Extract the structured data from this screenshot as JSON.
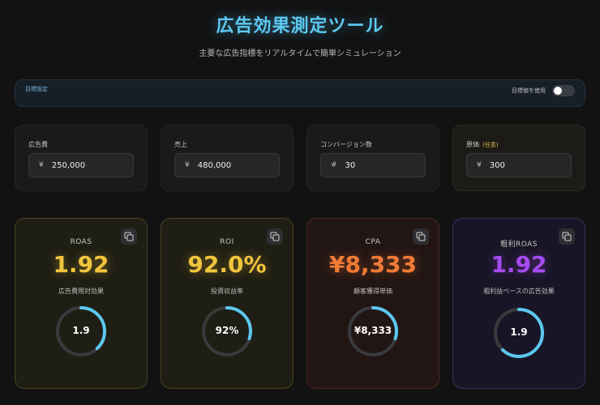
{
  "header": {
    "title": "広告効果測定ツール",
    "subtitle": "主要な広告指標をリアルタイムで簡単シミュレーション"
  },
  "goal": {
    "label": "目標設定",
    "toggle_label": "目標値を使用",
    "toggle_on": false
  },
  "inputs": [
    {
      "label": "広告費",
      "prefix": "¥",
      "value": "250,000"
    },
    {
      "label": "売上",
      "prefix": "¥",
      "value": "480,000"
    },
    {
      "label": "コンバージョン数",
      "prefix": "#",
      "value": "30"
    },
    {
      "label": "原価",
      "optional": "(任意)",
      "prefix": "¥",
      "value": "300"
    }
  ],
  "metrics": [
    {
      "name": "ROAS",
      "value": "1.92",
      "desc": "広告費用対効果",
      "gauge_text": "1.9",
      "gauge_fraction": 0.38,
      "color": "#f2c53d"
    },
    {
      "name": "ROI",
      "value": "92.0%",
      "desc": "投資収益率",
      "gauge_text": "92%",
      "gauge_fraction": 0.3,
      "color": "#f2c53d"
    },
    {
      "name": "CPA",
      "value": "¥8,333",
      "desc": "顧客獲得単価",
      "gauge_text": "¥8,333",
      "gauge_fraction": 0.3,
      "color": "#f07a36"
    },
    {
      "name": "粗利ROAS",
      "value": "1.92",
      "desc": "粗利益ベースの広告効果",
      "gauge_text": "1.9",
      "gauge_fraction": 0.62,
      "color": "#a64bf0"
    }
  ],
  "colors": {
    "accent": "#5cc8f0",
    "gauge_arc": "#5cc8f0",
    "gauge_track": "#3a3a3e"
  },
  "icons": {
    "copy": "copy-icon"
  }
}
